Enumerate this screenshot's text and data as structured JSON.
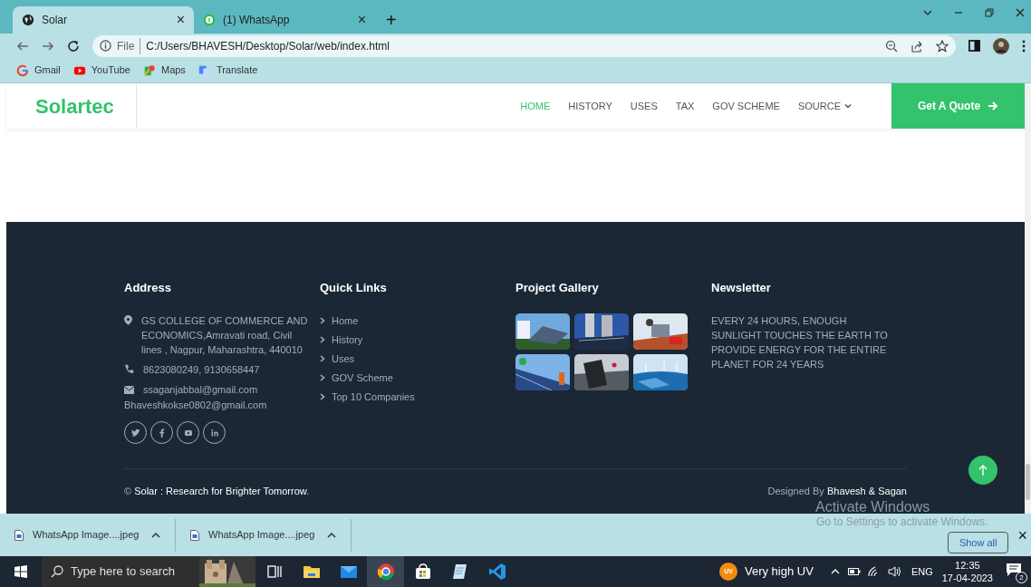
{
  "browser": {
    "tabs": [
      {
        "title": "Solar",
        "selected": true,
        "close": "×"
      },
      {
        "title": "(1) WhatsApp",
        "selected": false,
        "close": "×"
      }
    ],
    "new_tab": "+",
    "address": {
      "scheme": "File",
      "url": "C:/Users/BHAVESH/Desktop/Solar/web/index.html"
    },
    "bookmarks": [
      {
        "label": "Gmail"
      },
      {
        "label": "YouTube"
      },
      {
        "label": "Maps"
      },
      {
        "label": "Translate"
      }
    ]
  },
  "header": {
    "logo": "Solartec",
    "nav": [
      {
        "label": "HOME",
        "selected": true,
        "has_menu": false
      },
      {
        "label": "HISTORY",
        "selected": false,
        "has_menu": false
      },
      {
        "label": "USES",
        "selected": false,
        "has_menu": false
      },
      {
        "label": "TAX",
        "selected": false,
        "has_menu": false
      },
      {
        "label": "GOV SCHEME",
        "selected": false,
        "has_menu": false
      },
      {
        "label": "SOURCE",
        "selected": false,
        "has_menu": true
      }
    ],
    "quote_button": "Get A Quote"
  },
  "footer": {
    "address": {
      "heading": "Address",
      "location": "GS COLLEGE OF COMMERCE AND ECONOMICS,Amravati road, Civil lines , Nagpur, Maharashtra, 440010",
      "phone": "8623080249, 9130658447",
      "email": "ssaganjabbal@gmail.com",
      "email_2": "Bhaveshkokse0802@gmail.com"
    },
    "quick_links": {
      "heading": "Quick Links",
      "items": [
        "Home",
        "History",
        "Uses",
        "GOV Scheme",
        "Top 10 Companies"
      ]
    },
    "gallery": {
      "heading": "Project Gallery"
    },
    "newsletter": {
      "heading": "Newsletter",
      "text": "EVERY 24 HOURS, ENOUGH SUNLIGHT TOUCHES THE EARTH TO PROVIDE ENERGY FOR THE ENTIRE PLANET FOR 24 YEARS"
    },
    "copyright": {
      "symbol": "©",
      "link": "Solar : Research for Brighter Tomorrow",
      "end": "."
    },
    "credit": {
      "prefix": "Designed By",
      "names": "Bhavesh & Sagan"
    }
  },
  "activation": {
    "title": "Activate Windows",
    "subtitle": "Go to Settings to activate Windows."
  },
  "downloads": {
    "items": [
      {
        "name": "WhatsApp Image....jpeg"
      },
      {
        "name": "WhatsApp Image....jpeg"
      }
    ],
    "show_all": "Show all",
    "close": "×"
  },
  "taskbar": {
    "search_placeholder": "Type here to search",
    "weather_badge": "UV",
    "weather": "Very high UV",
    "language": "ENG",
    "time": "12:35",
    "date": "17-04-2023",
    "notifications": "2"
  }
}
